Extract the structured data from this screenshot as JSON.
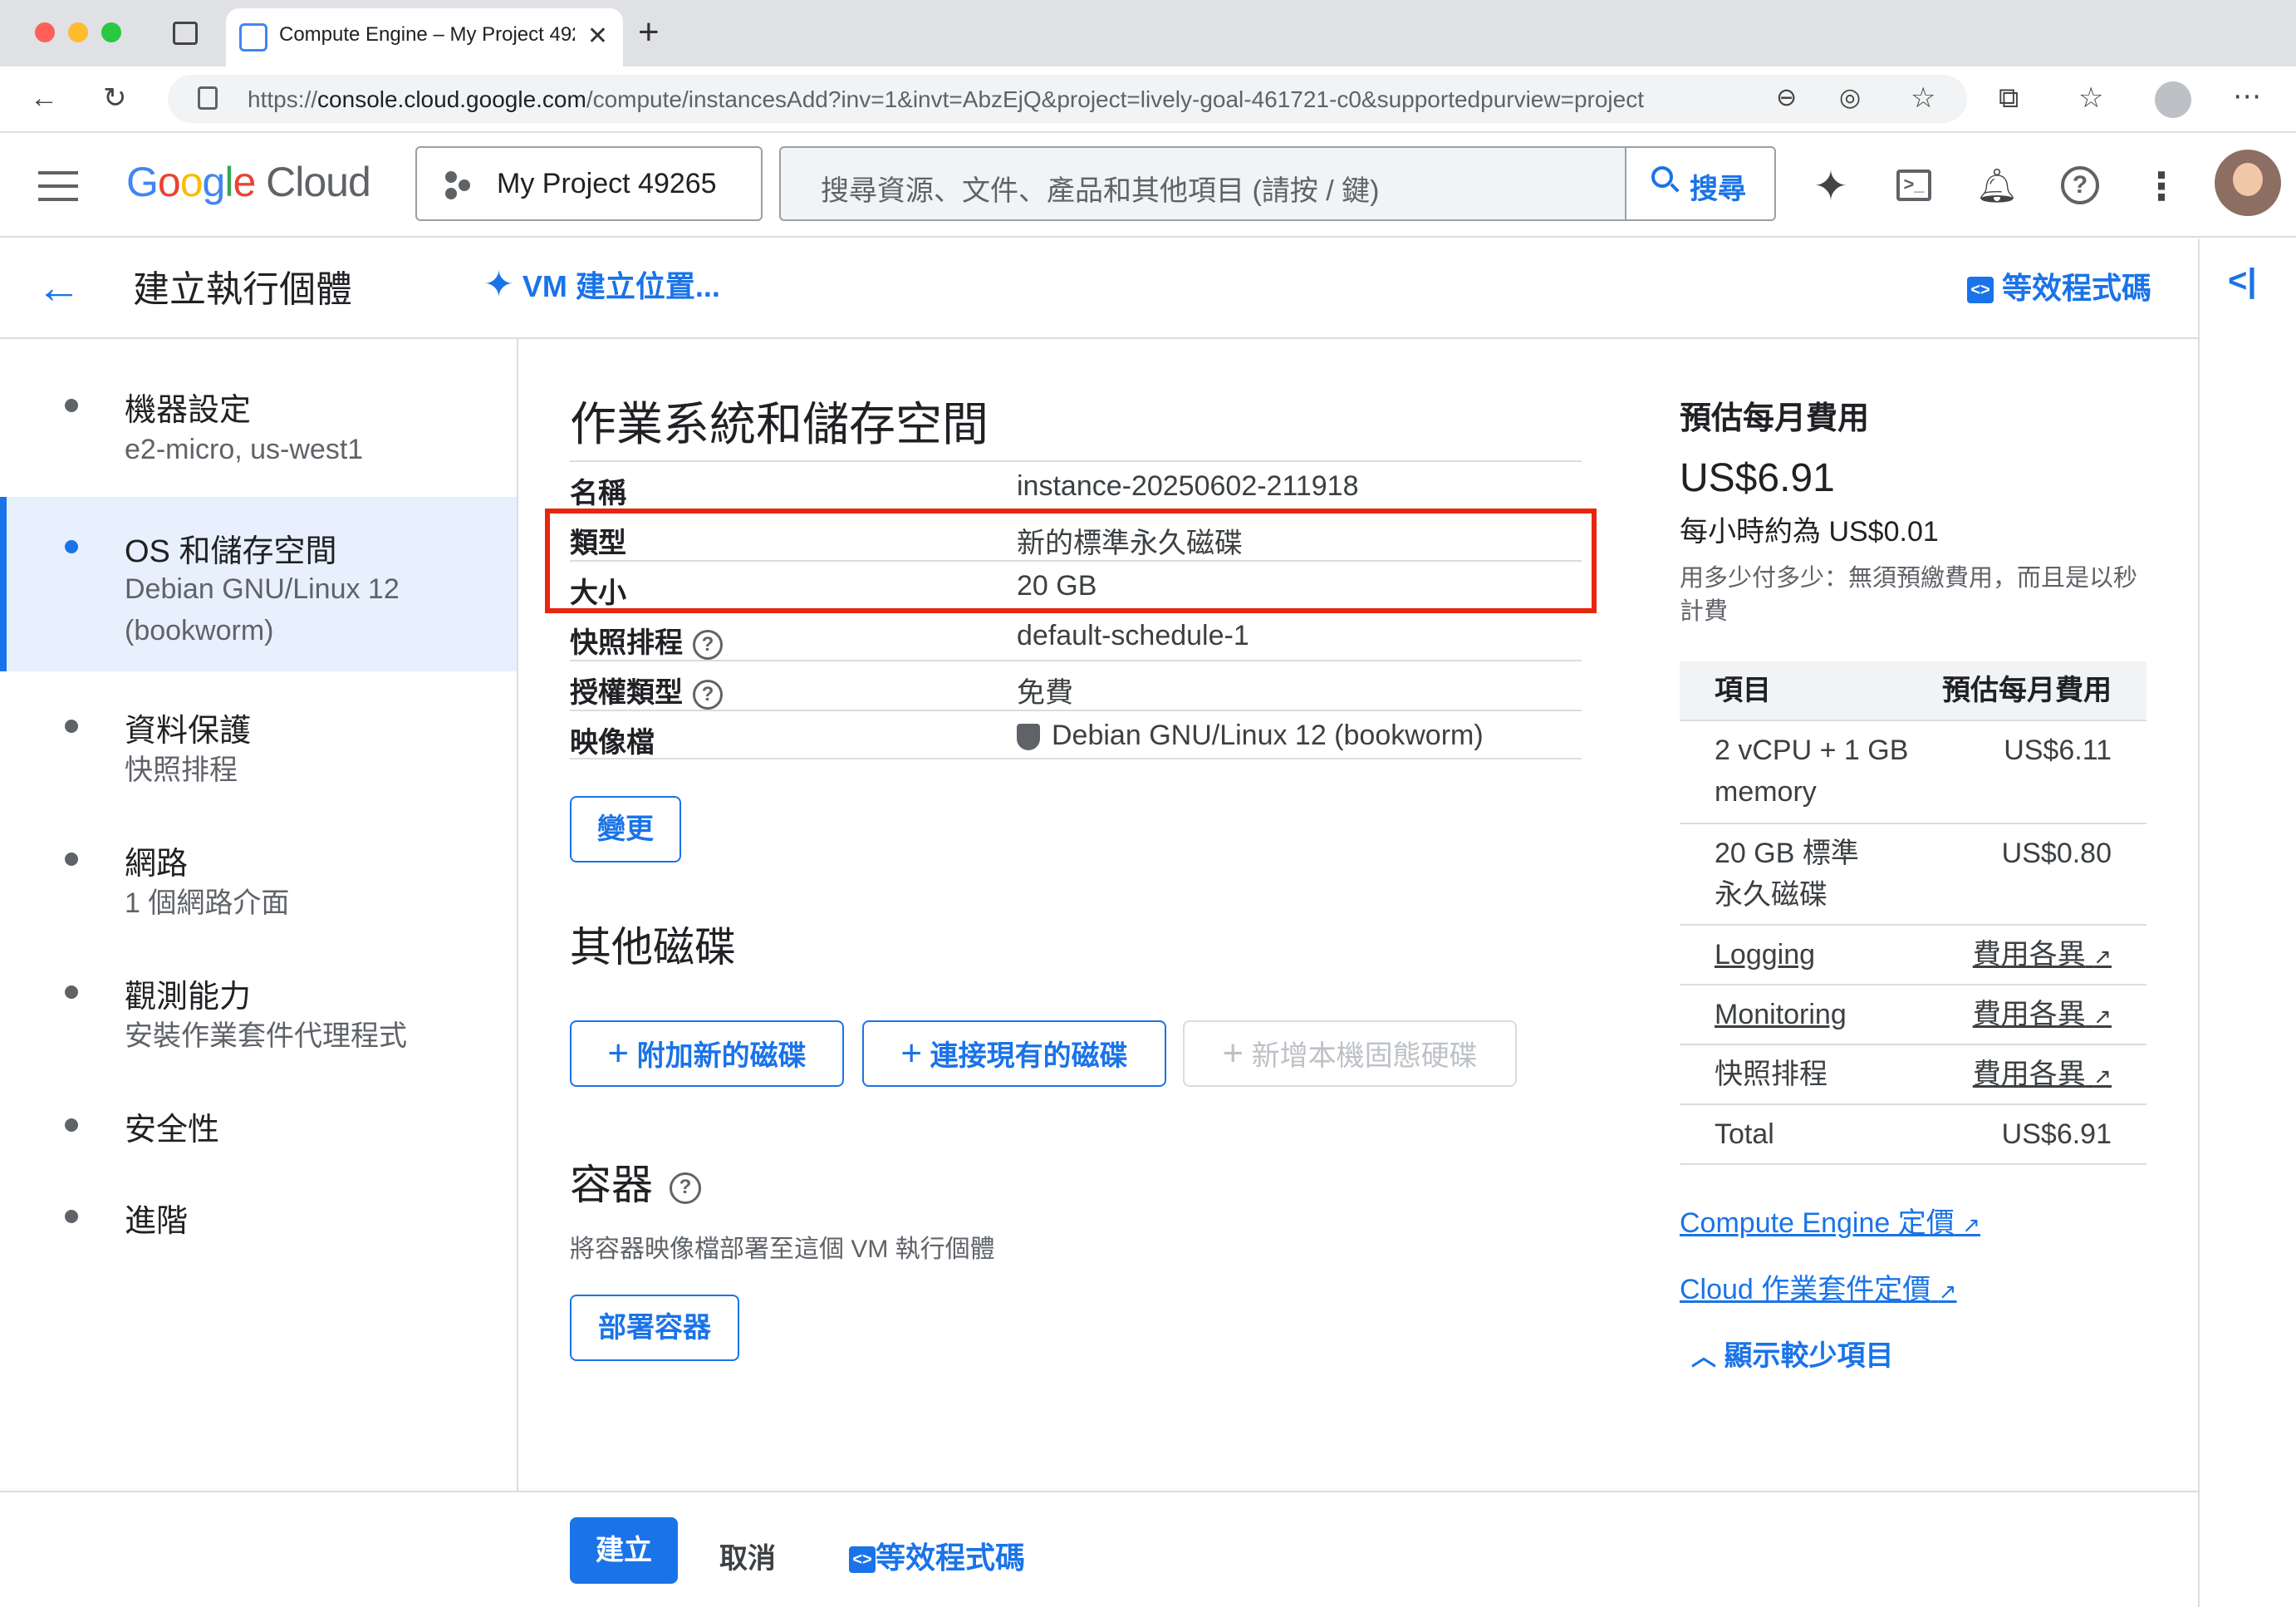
{
  "browser": {
    "tab_title": "Compute Engine – My Project 49265",
    "url_prefix": "https://",
    "url_host": "console.cloud.google.com",
    "url_path": "/compute/instancesAdd?inv=1&invt=AbzEjQ&project=lively-goal-461721-c0&supportedpurview=project"
  },
  "header": {
    "logo": "Google Cloud",
    "project": "My Project 49265",
    "search_placeholder": "搜尋資源、文件、產品和其他項目 (請按 / 鍵)",
    "search_button": "搜尋"
  },
  "page": {
    "title": "建立執行個體",
    "vm_location_link": "VM 建立位置...",
    "equiv_code": "等效程式碼"
  },
  "nav": [
    {
      "label": "機器設定",
      "sub": "e2-micro, us-west1"
    },
    {
      "label": "OS 和儲存空間",
      "sub": "Debian GNU/Linux 12 (bookworm)"
    },
    {
      "label": "資料保護",
      "sub": "快照排程"
    },
    {
      "label": "網路",
      "sub": "1 個網路介面"
    },
    {
      "label": "觀測能力",
      "sub": "安裝作業套件代理程式"
    },
    {
      "label": "安全性",
      "sub": ""
    },
    {
      "label": "進階",
      "sub": ""
    }
  ],
  "os_storage": {
    "heading": "作業系統和儲存空間",
    "rows": [
      {
        "key": "名稱",
        "value": "instance-20250602-211918"
      },
      {
        "key": "類型",
        "value": "新的標準永久磁碟"
      },
      {
        "key": "大小",
        "value": "20 GB"
      },
      {
        "key": "快照排程",
        "value": "default-schedule-1"
      },
      {
        "key": "授權類型",
        "value": "免費"
      },
      {
        "key": "映像檔",
        "value": "Debian GNU/Linux 12 (bookworm)"
      }
    ],
    "change_button": "變更"
  },
  "other_disks": {
    "heading": "其他磁碟",
    "add_new": "附加新的磁碟",
    "attach_existing": "連接現有的磁碟",
    "add_local_ssd": "新增本機固態硬碟"
  },
  "containers": {
    "heading": "容器",
    "description": "將容器映像檔部署至這個 VM 執行個體",
    "deploy_button": "部署容器"
  },
  "cost": {
    "heading": "預估每月費用",
    "monthly": "US$6.91",
    "hourly": "每小時約為 US$0.01",
    "note": "用多少付多少：無須預繳費用，而且是以秒計費",
    "table_header": [
      "項目",
      "預估每月費用"
    ],
    "rows": [
      {
        "item": "2 vCPU + 1 GB memory",
        "cost": "US$6.11"
      },
      {
        "item": "20 GB 標準永久磁碟",
        "cost": "US$0.80"
      },
      {
        "item": "Logging",
        "cost": "費用各異"
      },
      {
        "item": "Monitoring",
        "cost": "費用各異"
      },
      {
        "item": "快照排程",
        "cost": "費用各異"
      },
      {
        "item": "Total",
        "cost": "US$6.91"
      }
    ],
    "pricing_link_1": "Compute Engine 定價",
    "pricing_link_2": "Cloud 作業套件定價",
    "show_less": "顯示較少項目"
  },
  "footer": {
    "create": "建立",
    "cancel": "取消",
    "equiv_code": "等效程式碼"
  },
  "colors": {
    "accent": "#1a73e8",
    "highlight_box": "#e8250e",
    "selected_nav_bg": "#e8f0fe"
  }
}
